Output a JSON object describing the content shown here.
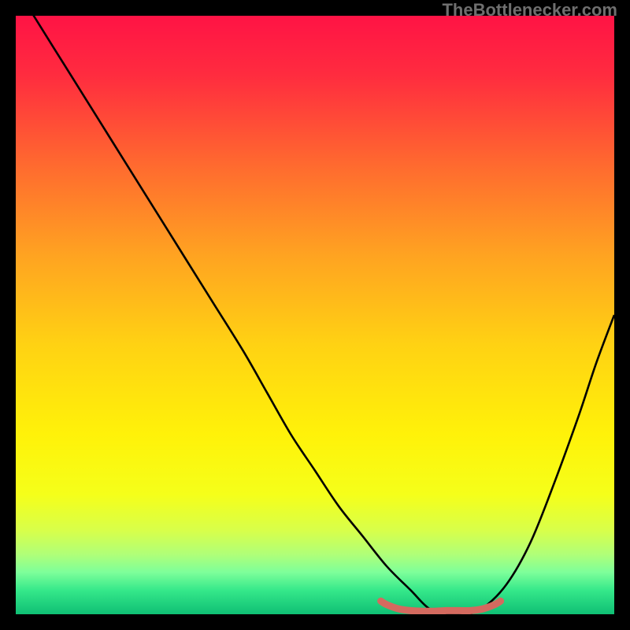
{
  "credit": {
    "text": "TheBottlenecker.com",
    "top": 0,
    "right": 16
  },
  "chart_data": {
    "type": "line",
    "title": "",
    "xlabel": "",
    "ylabel": "",
    "xlim": [
      0,
      100
    ],
    "ylim": [
      0,
      100
    ],
    "series": [
      {
        "name": "bottleneck-curve",
        "color": "#000000",
        "x": [
          0,
          3,
          8,
          13,
          18,
          23,
          28,
          33,
          38,
          42,
          46,
          50,
          54,
          58,
          62,
          66,
          69,
          72,
          75,
          78,
          82,
          86,
          90,
          94,
          97,
          100
        ],
        "y": [
          105,
          100,
          92,
          84,
          76,
          68,
          60,
          52,
          44,
          37,
          30,
          24,
          18,
          13,
          8,
          4,
          1,
          0,
          0,
          1,
          5,
          12,
          22,
          33,
          42,
          50
        ]
      },
      {
        "name": "optimum-band",
        "color": "#d46a5f",
        "x": [
          61,
          62,
          64,
          66,
          68,
          70,
          72,
          74,
          76,
          78,
          80,
          81
        ],
        "y": [
          2.2,
          1.6,
          0.9,
          0.6,
          0.5,
          0.5,
          0.6,
          0.6,
          0.6,
          0.9,
          1.6,
          2.2
        ]
      }
    ],
    "gradient_stops": [
      {
        "pos": 0.0,
        "color": "#ff1345"
      },
      {
        "pos": 0.1,
        "color": "#ff2c3f"
      },
      {
        "pos": 0.25,
        "color": "#ff6a2f"
      },
      {
        "pos": 0.4,
        "color": "#ffa321"
      },
      {
        "pos": 0.55,
        "color": "#ffd213"
      },
      {
        "pos": 0.7,
        "color": "#fff209"
      },
      {
        "pos": 0.8,
        "color": "#f5ff1a"
      },
      {
        "pos": 0.86,
        "color": "#d8ff4a"
      },
      {
        "pos": 0.9,
        "color": "#b0ff78"
      },
      {
        "pos": 0.93,
        "color": "#7dff9a"
      },
      {
        "pos": 0.96,
        "color": "#35e88a"
      },
      {
        "pos": 1.0,
        "color": "#0fbf74"
      }
    ]
  }
}
